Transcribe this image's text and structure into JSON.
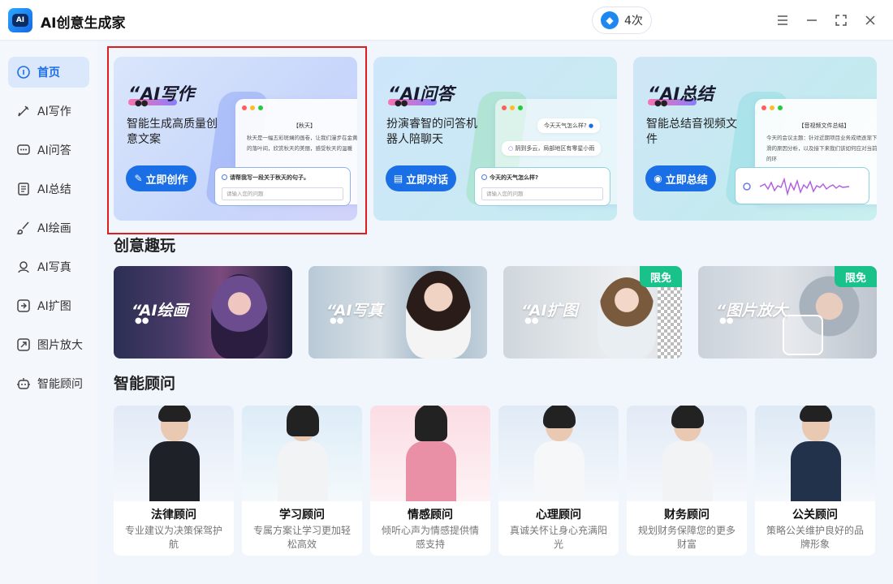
{
  "app": {
    "title": "AI创意生成家",
    "logo_text": "AI"
  },
  "header": {
    "quota_count": "4次",
    "icons": [
      "menu-icon",
      "minimize-icon",
      "maximize-icon",
      "close-icon"
    ]
  },
  "sidebar": {
    "items": [
      {
        "label": "首页",
        "icon": "home-icon",
        "active": true
      },
      {
        "label": "AI写作",
        "icon": "pen-icon"
      },
      {
        "label": "AI问答",
        "icon": "chat-icon"
      },
      {
        "label": "AI总结",
        "icon": "document-icon"
      },
      {
        "label": "AI绘画",
        "icon": "brush-icon"
      },
      {
        "label": "AI写真",
        "icon": "portrait-icon"
      },
      {
        "label": "AI扩图",
        "icon": "expand-icon"
      },
      {
        "label": "图片放大",
        "icon": "zoom-image-icon"
      },
      {
        "label": "智能顾问",
        "icon": "robot-icon"
      }
    ]
  },
  "features": [
    {
      "title": "AI写作",
      "desc": "智能生成高质量创意文案",
      "button": "立即创作",
      "mock_heading": "【秋天】",
      "mock_text": "秋天是一幅五彩斑斓的画卷，让我们漫步在金黄的落叶间，欣赏秋天的美丽，感受秋天的温暖",
      "prompt": "请帮我写一段关于秋天的句子。",
      "input_placeholder": "请输入您的问题"
    },
    {
      "title": "AI问答",
      "desc": "扮演睿智的问答机器人陪聊天",
      "button": "立即对话",
      "chat_question": "今天天气怎么样?",
      "chat_answer": "阴到多云，局部地区有零星小雨",
      "prompt": "今天的天气怎么样?",
      "input_placeholder": "请输入您的问题"
    },
    {
      "title": "AI总结",
      "desc": "智能总结音视频文件",
      "button": "立即总结",
      "mock_heading": "【音视频文件总结】",
      "mock_text": "今天的会议主题：针对近期项目业务成绩逐渐下滑的原因分析，以及接下来我们该如何应对当前的环"
    }
  ],
  "sections": {
    "creative": "创意趣玩",
    "advisors": "智能顾问"
  },
  "creative_cards": [
    {
      "title": "AI绘画",
      "badge": ""
    },
    {
      "title": "AI写真",
      "badge": ""
    },
    {
      "title": "AI扩图",
      "badge": "限免"
    },
    {
      "title": "图片放大",
      "badge": "限免"
    }
  ],
  "advisors": [
    {
      "name": "法律顾问",
      "desc": "专业建议为决策保驾护航"
    },
    {
      "name": "学习顾问",
      "desc": "专属方案让学习更加轻松高效"
    },
    {
      "name": "情感顾问",
      "desc": "倾听心声为情感提供情感支持"
    },
    {
      "name": "心理顾问",
      "desc": "真诚关怀让身心充满阳光"
    },
    {
      "name": "财务顾问",
      "desc": "规划财务保障您的更多财富"
    },
    {
      "name": "公关顾问",
      "desc": "策略公关维护良好的品牌形象"
    }
  ],
  "colors": {
    "accent": "#1a6fe6",
    "badge": "#19c28a",
    "selection": "#e01c1c"
  }
}
